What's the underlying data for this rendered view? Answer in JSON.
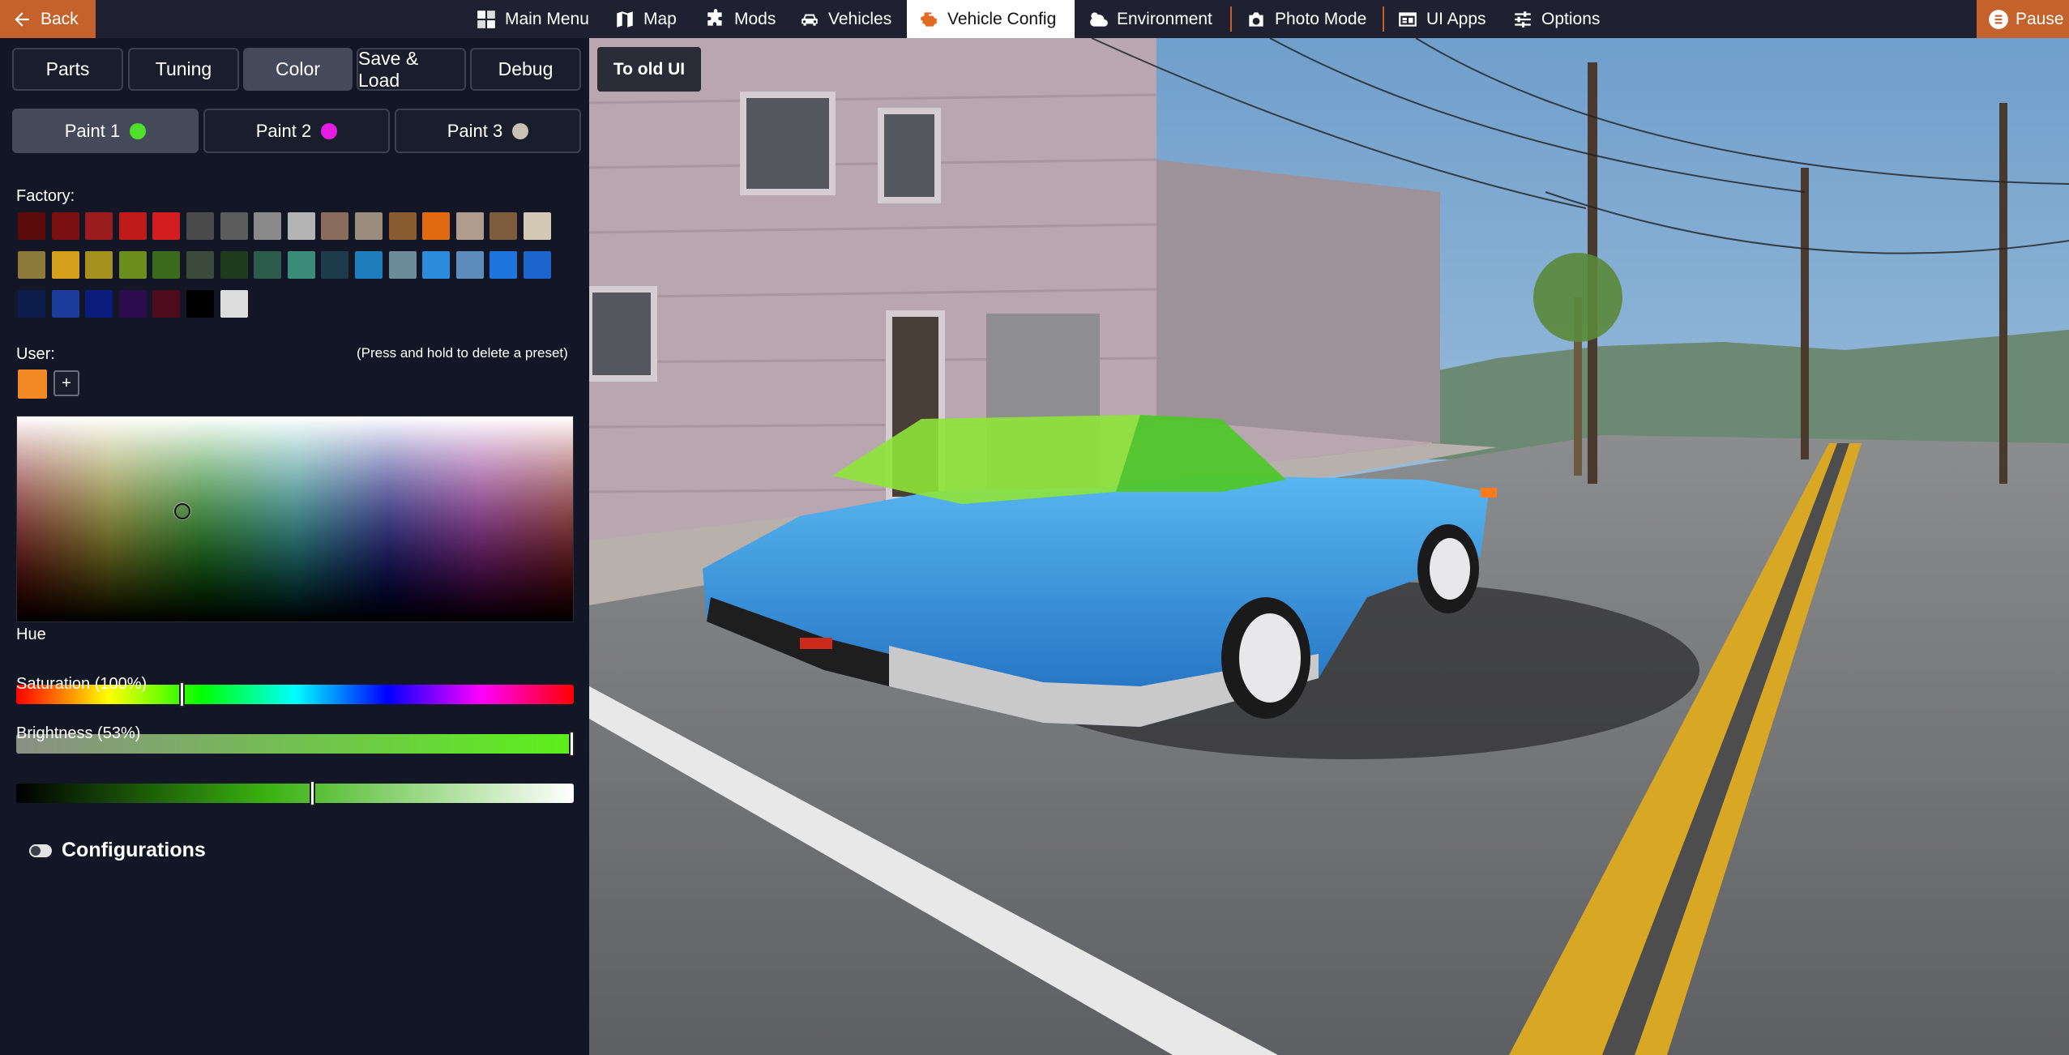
{
  "topbar": {
    "back_label": "Back",
    "items": [
      {
        "label": "Main Menu",
        "icon": "grid-icon"
      },
      {
        "label": "Map",
        "icon": "map-icon"
      },
      {
        "label": "Mods",
        "icon": "puzzle-icon"
      },
      {
        "label": "Vehicles",
        "icon": "car-icon"
      },
      {
        "label": "Vehicle Config",
        "icon": "engine-icon",
        "active": true
      },
      {
        "label": "Environment",
        "icon": "weather-icon"
      },
      {
        "label": "Photo Mode",
        "icon": "camera-icon"
      },
      {
        "label": "UI Apps",
        "icon": "ui-apps-icon"
      },
      {
        "label": "Options",
        "icon": "sliders-icon"
      }
    ],
    "pause_label": "Pause"
  },
  "panel": {
    "tabs": [
      "Parts",
      "Tuning",
      "Color",
      "Save & Load",
      "Debug"
    ],
    "active_tab": "Color",
    "old_ui_label": "To old UI",
    "paints": [
      {
        "label": "Paint 1",
        "color": "#4ee02a",
        "active": true
      },
      {
        "label": "Paint 2",
        "color": "#e41ce4"
      },
      {
        "label": "Paint 3",
        "color": "#c8c2b4"
      }
    ],
    "factory_label": "Factory:",
    "factory_colors": [
      "#5c0a0a",
      "#7a1010",
      "#9a1c1c",
      "#c01b1b",
      "#d21e1e",
      "#4a4a4a",
      "#5c5c5c",
      "#8a8a8a",
      "#b4b4b4",
      "#8a6c5c",
      "#9a8c7c",
      "#8a5a30",
      "#e06a10",
      "#b09c8c",
      "#7c5c3c",
      "#d2c8b4",
      "#8c7a3a",
      "#d4a01c",
      "#a4901c",
      "#6c8c1c",
      "#3a6a1c",
      "#3c4a3c",
      "#1c3c1c",
      "#2c5c4c",
      "#3c8c7c",
      "#1c3c4c",
      "#1c7cbc",
      "#6c8c9c",
      "#2c8cdc",
      "#5c8cbc",
      "#1c74dc",
      "#1c64cc",
      "#0c1c4c",
      "#1c3c9c",
      "#0c1c7c",
      "#2c0c4c",
      "#4c0c1c",
      "#000000",
      "#dcdcdc"
    ],
    "user_label": "User:",
    "user_hint": "(Press and hold to delete a preset)",
    "user_colors": [
      "#f38a26"
    ],
    "add_label": "+",
    "picker": {
      "hue_deg": 107,
      "saturation_pct": 100,
      "brightness_pct": 53
    },
    "hue_label": "Hue",
    "saturation_label": "Saturation (100%)",
    "brightness_label": "Brightness (53%)",
    "configurations_label": "Configurations"
  },
  "colors": {
    "accent": "#c5622b",
    "panel_bg": "#131725",
    "topbar_bg": "#1f2130"
  }
}
